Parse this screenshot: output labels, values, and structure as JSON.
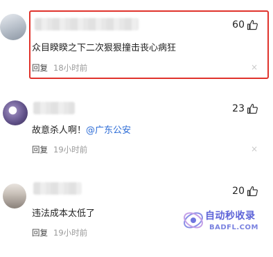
{
  "comments": [
    {
      "likes": "60",
      "text": "众目睽睽之下二次狠狠撞击丧心病狂",
      "reply_label": "回复",
      "time": "18小时前",
      "close": "×",
      "highlighted": true
    },
    {
      "likes": "23",
      "text_prefix": "故意杀人啊！",
      "mention": "@广东公安",
      "reply_label": "回复",
      "time": "19小时前",
      "close": "×"
    },
    {
      "likes": "20",
      "text": "违法成本太低了",
      "reply_label": "回复",
      "time": "19小时前",
      "close": "×"
    }
  ],
  "watermark": {
    "line1": "自动秒收录",
    "line2": "BADFL.COM"
  },
  "colors": {
    "highlight_border": "#e0322b",
    "mention": "#2b6bd6",
    "time": "#999999"
  },
  "icons": [
    "thumbs-up-icon",
    "close-icon",
    "watermark-logo-icon"
  ]
}
